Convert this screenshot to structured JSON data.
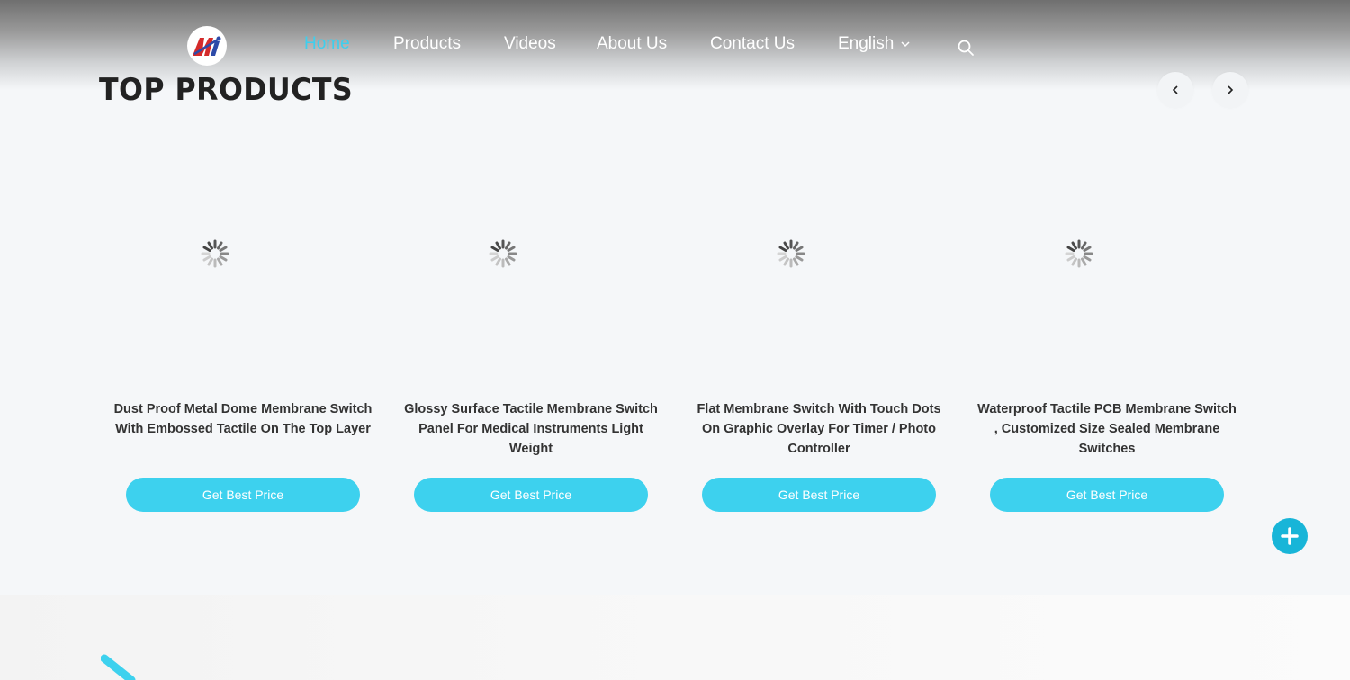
{
  "nav": {
    "items": [
      {
        "label": "Home",
        "active": true
      },
      {
        "label": "Products"
      },
      {
        "label": "Videos"
      },
      {
        "label": "About Us"
      },
      {
        "label": "Contact Us"
      }
    ],
    "language": "English"
  },
  "section": {
    "title": "TOP PRODUCTS"
  },
  "products": [
    {
      "title": "Dust Proof Metal Dome Membrane Switch With Embossed Tactile On The Top Layer",
      "button": "Get Best Price"
    },
    {
      "title": "Glossy Surface Tactile Membrane Switch Panel For Medical Instruments Light Weight",
      "button": "Get Best Price"
    },
    {
      "title": "Flat Membrane Switch With Touch Dots On Graphic Overlay For Timer / Photo Controller",
      "button": "Get Best Price"
    },
    {
      "title": "Waterproof Tactile PCB Membrane Switch , Customized Size Sealed Membrane Switches",
      "button": "Get Best Price"
    }
  ],
  "colors": {
    "accent": "#3dd1ee",
    "nav_active": "#3dcfee",
    "fab": "#18b5d8"
  },
  "icons": {
    "search": "search-icon",
    "prev": "chevron-left-icon",
    "next": "chevron-right-icon",
    "language_dropdown": "chevron-down-icon",
    "loading": "loading-spinner-icon",
    "expand": "plus-icon"
  }
}
